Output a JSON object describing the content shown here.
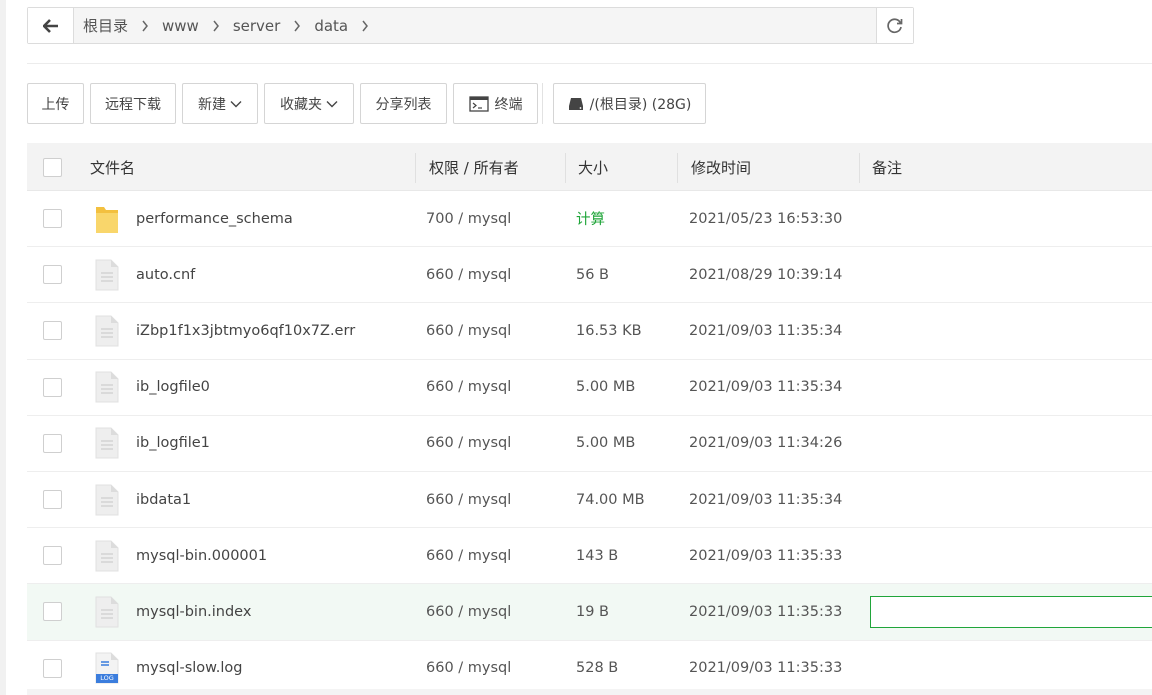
{
  "breadcrumbs": [
    "根目录",
    "www",
    "server",
    "data"
  ],
  "toolbar": {
    "upload": "上传",
    "remote_download": "远程下载",
    "new": "新建",
    "favorites": "收藏夹",
    "share_list": "分享列表",
    "terminal": "终端",
    "disk": "/(根目录) (28G)"
  },
  "columns": {
    "name": "文件名",
    "perm": "权限 / 所有者",
    "size": "大小",
    "mtime": "修改时间",
    "note": "备注"
  },
  "files": [
    {
      "name": "performance_schema",
      "perm": "700 / mysql",
      "size": "计算",
      "mtime": "2021/05/23 16:53:30",
      "type": "folder-icon"
    },
    {
      "name": "auto.cnf",
      "perm": "660 / mysql",
      "size": "56 B",
      "mtime": "2021/08/29 10:39:14",
      "type": "file-icon"
    },
    {
      "name": "iZbp1f1x3jbtmyo6qf10x7Z.err",
      "perm": "660 / mysql",
      "size": "16.53 KB",
      "mtime": "2021/09/03 11:35:34",
      "type": "file-icon"
    },
    {
      "name": "ib_logfile0",
      "perm": "660 / mysql",
      "size": "5.00 MB",
      "mtime": "2021/09/03 11:35:34",
      "type": "file-icon"
    },
    {
      "name": "ib_logfile1",
      "perm": "660 / mysql",
      "size": "5.00 MB",
      "mtime": "2021/09/03 11:34:26",
      "type": "file-icon"
    },
    {
      "name": "ibdata1",
      "perm": "660 / mysql",
      "size": "74.00 MB",
      "mtime": "2021/09/03 11:35:34",
      "type": "file-icon"
    },
    {
      "name": "mysql-bin.000001",
      "perm": "660 / mysql",
      "size": "143 B",
      "mtime": "2021/09/03 11:35:33",
      "type": "file-icon"
    },
    {
      "name": "mysql-bin.index",
      "perm": "660 / mysql",
      "size": "19 B",
      "mtime": "2021/09/03 11:35:33",
      "type": "file-icon"
    },
    {
      "name": "mysql-slow.log",
      "perm": "660 / mysql",
      "size": "528 B",
      "mtime": "2021/09/03 11:35:33",
      "type": "log-file-icon"
    }
  ],
  "log_icon_label": "LOG",
  "colors": {
    "accent": "#20a53a",
    "folder": "#f7c948",
    "log_icon": "#3b7ddd"
  }
}
